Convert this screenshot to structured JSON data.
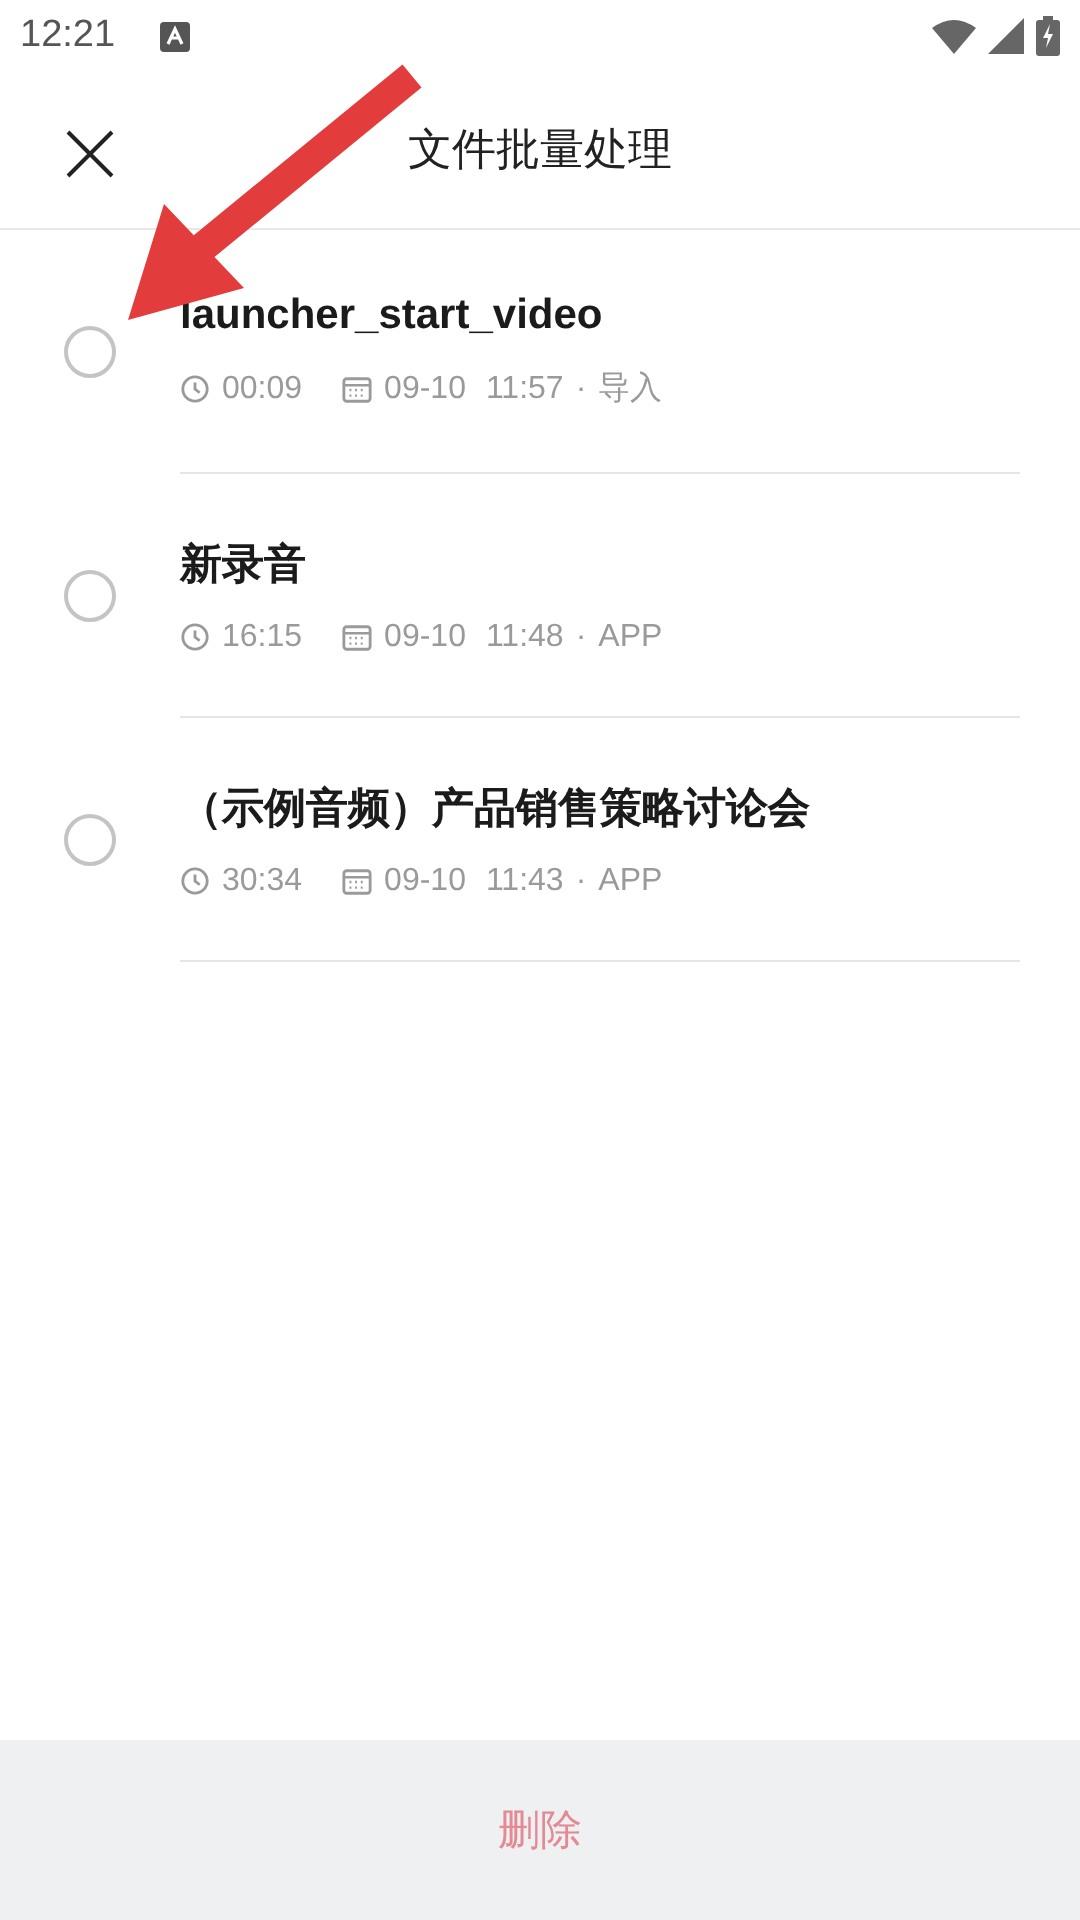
{
  "status_bar": {
    "time": "12:21"
  },
  "header": {
    "title": "文件批量处理"
  },
  "files": [
    {
      "name": "launcher_start_video",
      "duration": "00:09",
      "date": "09-10",
      "time": "11:57",
      "separator": "·",
      "source": "导入",
      "selected": false
    },
    {
      "name": "新录音",
      "duration": "16:15",
      "date": "09-10",
      "time": "11:48",
      "separator": "·",
      "source": "APP",
      "selected": false
    },
    {
      "name": "（示例音频）产品销售策略讨论会",
      "duration": "30:34",
      "date": "09-10",
      "time": "11:43",
      "separator": "·",
      "source": "APP",
      "selected": false
    }
  ],
  "delete_button": {
    "label": "删除",
    "disabled": true
  }
}
